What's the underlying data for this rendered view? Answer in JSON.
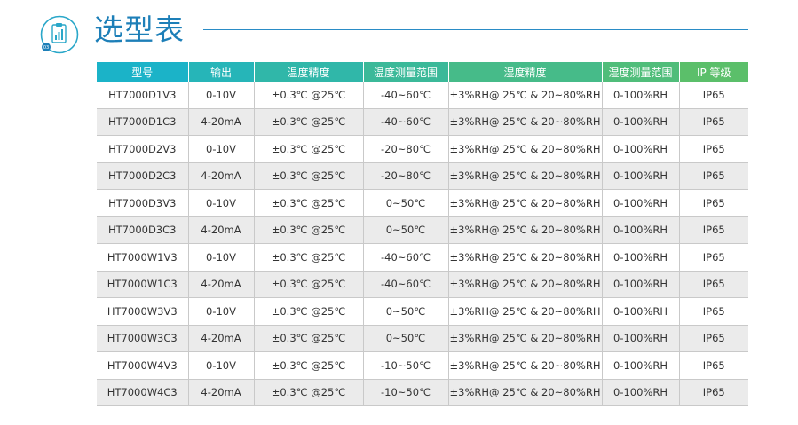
{
  "header": {
    "title": "选型表",
    "badge": "03",
    "icon": "clipboard-chart-icon",
    "accent_color": "#1d7fb8"
  },
  "table": {
    "header_gradient": [
      "#1bb3c8",
      "#5bbf6a"
    ],
    "columns": [
      "型号",
      "输出",
      "温度精度",
      "温度测量范围",
      "湿度精度",
      "湿度测量范围",
      "IP 等级"
    ],
    "rows": [
      [
        "HT7000D1V3",
        "0-10V",
        "±0.3℃ @25℃",
        "-40~60℃",
        "±3%RH@ 25℃ & 20~80%RH",
        "0-100%RH",
        "IP65"
      ],
      [
        "HT7000D1C3",
        "4-20mA",
        "±0.3℃ @25℃",
        "-40~60℃",
        "±3%RH@ 25℃ & 20~80%RH",
        "0-100%RH",
        "IP65"
      ],
      [
        "HT7000D2V3",
        "0-10V",
        "±0.3℃ @25℃",
        "-20~80℃",
        "±3%RH@ 25℃ & 20~80%RH",
        "0-100%RH",
        "IP65"
      ],
      [
        "HT7000D2C3",
        "4-20mA",
        "±0.3℃ @25℃",
        "-20~80℃",
        "±3%RH@ 25℃ & 20~80%RH",
        "0-100%RH",
        "IP65"
      ],
      [
        "HT7000D3V3",
        "0-10V",
        "±0.3℃ @25℃",
        "0~50℃",
        "±3%RH@ 25℃ & 20~80%RH",
        "0-100%RH",
        "IP65"
      ],
      [
        "HT7000D3C3",
        "4-20mA",
        "±0.3℃ @25℃",
        "0~50℃",
        "±3%RH@ 25℃ & 20~80%RH",
        "0-100%RH",
        "IP65"
      ],
      [
        "HT7000W1V3",
        "0-10V",
        "±0.3℃ @25℃",
        "-40~60℃",
        "±3%RH@ 25℃ & 20~80%RH",
        "0-100%RH",
        "IP65"
      ],
      [
        "HT7000W1C3",
        "4-20mA",
        "±0.3℃ @25℃",
        "-40~60℃",
        "±3%RH@ 25℃ & 20~80%RH",
        "0-100%RH",
        "IP65"
      ],
      [
        "HT7000W3V3",
        "0-10V",
        "±0.3℃ @25℃",
        "0~50℃",
        "±3%RH@ 25℃ & 20~80%RH",
        "0-100%RH",
        "IP65"
      ],
      [
        "HT7000W3C3",
        "4-20mA",
        "±0.3℃ @25℃",
        "0~50℃",
        "±3%RH@ 25℃ & 20~80%RH",
        "0-100%RH",
        "IP65"
      ],
      [
        "HT7000W4V3",
        "0-10V",
        "±0.3℃ @25℃",
        "-10~50℃",
        "±3%RH@ 25℃ & 20~80%RH",
        "0-100%RH",
        "IP65"
      ],
      [
        "HT7000W4C3",
        "4-20mA",
        "±0.3℃ @25℃",
        "-10~50℃",
        "±3%RH@ 25℃ & 20~80%RH",
        "0-100%RH",
        "IP65"
      ]
    ]
  }
}
